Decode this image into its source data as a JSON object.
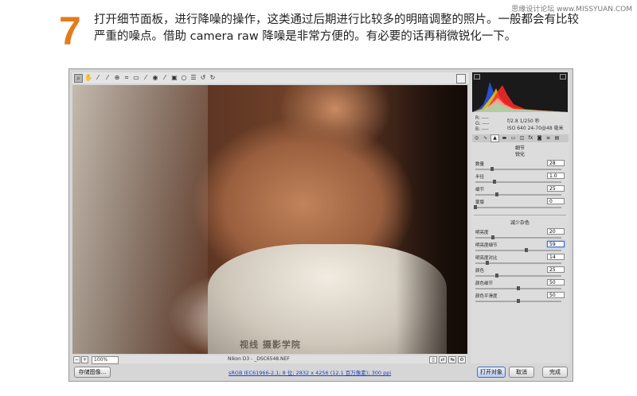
{
  "site_watermark": "思缘设计论坛 www.MISSYUAN.COM",
  "step": {
    "number": "7",
    "text": "打开细节面板，进行降噪的操作，这类通过后期进行比较多的明暗调整的照片。一般都会有比较严重的噪点。借助 camera raw 降噪是非常方便的。有必要的话再稍微锐化一下。"
  },
  "toolbar": {
    "tools": [
      "zoom-icon",
      "hand-icon",
      "white-balance-icon",
      "color-sampler-icon",
      "target-adjust-icon",
      "crop-icon",
      "straighten-icon",
      "spot-removal-icon",
      "red-eye-icon",
      "adjustment-brush-icon",
      "graduated-filter-icon",
      "radial-filter-icon",
      "rotate-ccw-icon",
      "rotate-cw-icon"
    ]
  },
  "image": {
    "watermark": "视线 摄影学院"
  },
  "statusbar": {
    "zoom": "100%",
    "filename": "Nikon D3 - _DSC6548.NEF"
  },
  "info": {
    "rgb": [
      "R: ----",
      "G: ----",
      "B: ----"
    ],
    "exif_line1": "f/2.8   1/250 秒",
    "exif_line2": "ISO 640   24-70@48 毫米"
  },
  "panel": {
    "title": "细节",
    "sharpen": {
      "title": "锐化",
      "sliders": [
        {
          "label": "数量",
          "value": "28",
          "fraction": 0.19
        },
        {
          "label": "半径",
          "value": "1.0",
          "fraction": 0.22
        },
        {
          "label": "细节",
          "value": "25",
          "fraction": 0.25
        },
        {
          "label": "蒙版",
          "value": "0",
          "fraction": 0.0
        }
      ]
    },
    "noise": {
      "title": "减少杂色",
      "sliders": [
        {
          "label": "明亮度",
          "value": "20",
          "fraction": 0.2
        },
        {
          "label": "明亮度细节",
          "value": "59",
          "fraction": 0.59,
          "focused": true
        },
        {
          "label": "明亮度对比",
          "value": "14",
          "fraction": 0.14
        },
        {
          "label": "颜色",
          "value": "25",
          "fraction": 0.25
        },
        {
          "label": "颜色细节",
          "value": "50",
          "fraction": 0.5
        },
        {
          "label": "颜色平滑度",
          "value": "50",
          "fraction": 0.5
        }
      ]
    }
  },
  "bottom": {
    "save_label": "存储图像...",
    "workflow_link": "sRGB IEC61966-2.1; 8 位; 2832 x 4256 (12.1 百万像素); 300 ppi",
    "open_label": "打开对象",
    "cancel_label": "取消",
    "done_label": "完成"
  }
}
